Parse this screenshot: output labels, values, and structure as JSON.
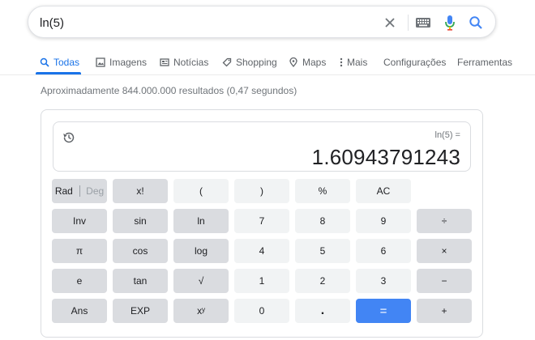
{
  "search": {
    "query": "ln(5)"
  },
  "tabs": [
    {
      "label": "Todas",
      "icon": "search-icon"
    },
    {
      "label": "Imagens",
      "icon": "image-icon"
    },
    {
      "label": "Notícias",
      "icon": "news-icon"
    },
    {
      "label": "Shopping",
      "icon": "tag-icon"
    },
    {
      "label": "Maps",
      "icon": "map-pin-icon"
    },
    {
      "label": "Mais",
      "icon": "more-vert-icon"
    },
    {
      "label": "Configurações"
    },
    {
      "label": "Ferramentas"
    }
  ],
  "results_stats": "Aproximadamente 844.000.000 resultados (0,47 segundos)",
  "calculator": {
    "expression": "ln(5) =",
    "result": "1.60943791243",
    "keys": {
      "rad": "Rad",
      "deg": "Deg",
      "fact": "x!",
      "lparen": "(",
      "rparen": ")",
      "percent": "%",
      "ac": "AC",
      "inv": "Inv",
      "sin": "sin",
      "ln": "ln",
      "k7": "7",
      "k8": "8",
      "k9": "9",
      "divide": "÷",
      "pi": "π",
      "cos": "cos",
      "log": "log",
      "k4": "4",
      "k5": "5",
      "k6": "6",
      "multiply": "×",
      "e": "e",
      "tan": "tan",
      "sqrt": "√",
      "k1": "1",
      "k2": "2",
      "k3": "3",
      "minus": "−",
      "ans": "Ans",
      "exp": "EXP",
      "pow": "xʸ",
      "k0": "0",
      "dot": ".",
      "equals": "=",
      "plus": "+"
    }
  },
  "colors": {
    "accent": "#1a73e8",
    "equals_key": "#4285f4",
    "mic_red": "#ea4335"
  }
}
